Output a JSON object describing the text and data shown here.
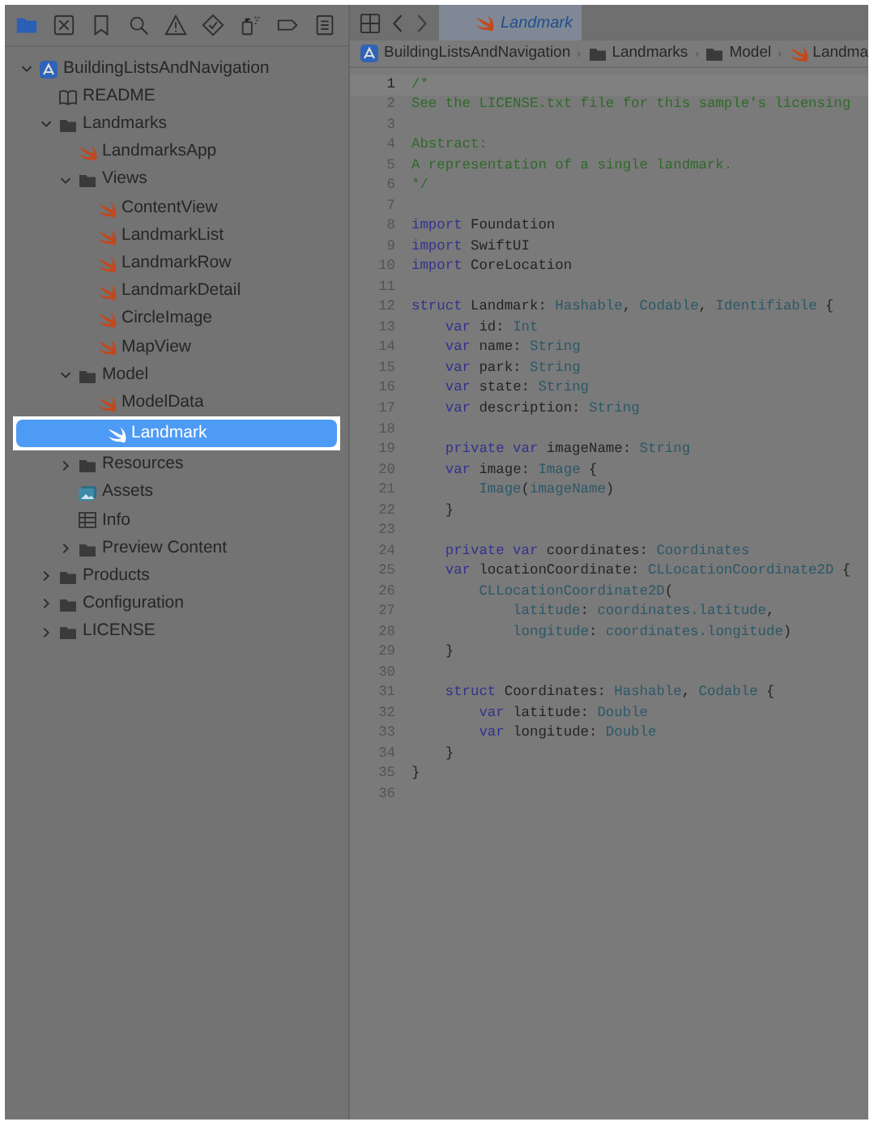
{
  "navigator_tabs": [
    {
      "kind": "folder",
      "selected": true
    },
    {
      "kind": "xsquare",
      "selected": false
    },
    {
      "kind": "bookmark",
      "selected": false
    },
    {
      "kind": "search",
      "selected": false
    },
    {
      "kind": "warning",
      "selected": false
    },
    {
      "kind": "diamond",
      "selected": false
    },
    {
      "kind": "spray",
      "selected": false
    },
    {
      "kind": "capsule",
      "selected": false
    },
    {
      "kind": "doclist",
      "selected": false
    }
  ],
  "editor_tab": {
    "label": "Landmark",
    "kind": "swift"
  },
  "breadcrumb": [
    {
      "label": "BuildingListsAndNavigation",
      "kind": "project"
    },
    {
      "label": "Landmarks",
      "kind": "folder"
    },
    {
      "label": "Model",
      "kind": "folder"
    },
    {
      "label": "Landma",
      "kind": "swift"
    }
  ],
  "tree": [
    {
      "label": "BuildingListsAndNavigation",
      "kind": "project",
      "expanded": true,
      "selected": false,
      "children": [
        {
          "label": "README",
          "kind": "book",
          "selected": false
        },
        {
          "label": "Landmarks",
          "kind": "folder",
          "expanded": true,
          "selected": false,
          "children": [
            {
              "label": "LandmarksApp",
              "kind": "swift",
              "selected": false
            },
            {
              "label": "Views",
              "kind": "folder",
              "expanded": true,
              "selected": false,
              "children": [
                {
                  "label": "ContentView",
                  "kind": "swift",
                  "selected": false
                },
                {
                  "label": "LandmarkList",
                  "kind": "swift",
                  "selected": false
                },
                {
                  "label": "LandmarkRow",
                  "kind": "swift",
                  "selected": false
                },
                {
                  "label": "LandmarkDetail",
                  "kind": "swift",
                  "selected": false
                },
                {
                  "label": "CircleImage",
                  "kind": "swift",
                  "selected": false
                },
                {
                  "label": "MapView",
                  "kind": "swift",
                  "selected": false
                }
              ]
            },
            {
              "label": "Model",
              "kind": "folder",
              "expanded": true,
              "selected": false,
              "children": [
                {
                  "label": "ModelData",
                  "kind": "swift",
                  "selected": false
                },
                {
                  "label": "Landmark",
                  "kind": "swift",
                  "selected": true
                }
              ]
            },
            {
              "label": "Resources",
              "kind": "folder",
              "expanded": false,
              "selected": false
            },
            {
              "label": "Assets",
              "kind": "assets",
              "selected": false
            },
            {
              "label": "Info",
              "kind": "plist",
              "selected": false
            },
            {
              "label": "Preview Content",
              "kind": "folder",
              "expanded": false,
              "selected": false
            }
          ]
        },
        {
          "label": "Products",
          "kind": "folder",
          "expanded": false,
          "selected": false
        },
        {
          "label": "Configuration",
          "kind": "folder",
          "expanded": false,
          "selected": false
        },
        {
          "label": "LICENSE",
          "kind": "folder",
          "expanded": false,
          "selected": false
        }
      ]
    }
  ],
  "code_lines": [
    {
      "number": "1",
      "current": true,
      "tokens": [
        {
          "kind": "comment",
          "text": "/*"
        }
      ]
    },
    {
      "number": "2",
      "current": false,
      "tokens": [
        {
          "kind": "comment",
          "text": "See the LICENSE.txt file for this sample's licensing"
        }
      ]
    },
    {
      "number": "3",
      "current": false
    },
    {
      "number": "4",
      "current": false,
      "tokens": [
        {
          "kind": "comment",
          "text": "Abstract:"
        }
      ]
    },
    {
      "number": "5",
      "current": false,
      "tokens": [
        {
          "kind": "comment",
          "text": "A representation of a single landmark."
        }
      ]
    },
    {
      "number": "6",
      "current": false,
      "tokens": [
        {
          "kind": "comment",
          "text": "*/"
        }
      ]
    },
    {
      "number": "7",
      "current": false
    },
    {
      "number": "8",
      "current": false,
      "tokens": [
        {
          "kind": "keyword",
          "text": "import"
        },
        {
          "kind": "plain",
          "text": " Foundation"
        }
      ]
    },
    {
      "number": "9",
      "current": false,
      "tokens": [
        {
          "kind": "keyword",
          "text": "import"
        },
        {
          "kind": "plain",
          "text": " SwiftUI"
        }
      ]
    },
    {
      "number": "10",
      "current": false,
      "tokens": [
        {
          "kind": "keyword",
          "text": "import"
        },
        {
          "kind": "plain",
          "text": " CoreLocation"
        }
      ]
    },
    {
      "number": "11",
      "current": false
    },
    {
      "number": "12",
      "current": false,
      "tokens": [
        {
          "kind": "keyword",
          "text": "struct"
        },
        {
          "kind": "plain",
          "text": " Landmark: "
        },
        {
          "kind": "type",
          "text": "Hashable"
        },
        {
          "kind": "plain",
          "text": ", "
        },
        {
          "kind": "type",
          "text": "Codable"
        },
        {
          "kind": "plain",
          "text": ", "
        },
        {
          "kind": "type",
          "text": "Identifiable"
        },
        {
          "kind": "plain",
          "text": " {"
        }
      ]
    },
    {
      "number": "13",
      "current": false,
      "tokens": [
        {
          "kind": "keyword",
          "text": "    var"
        },
        {
          "kind": "plain",
          "text": " id: "
        },
        {
          "kind": "type",
          "text": "Int"
        }
      ]
    },
    {
      "number": "14",
      "current": false,
      "tokens": [
        {
          "kind": "keyword",
          "text": "    var"
        },
        {
          "kind": "plain",
          "text": " name: "
        },
        {
          "kind": "type",
          "text": "String"
        }
      ]
    },
    {
      "number": "15",
      "current": false,
      "tokens": [
        {
          "kind": "keyword",
          "text": "    var"
        },
        {
          "kind": "plain",
          "text": " park: "
        },
        {
          "kind": "type",
          "text": "String"
        }
      ]
    },
    {
      "number": "16",
      "current": false,
      "tokens": [
        {
          "kind": "keyword",
          "text": "    var"
        },
        {
          "kind": "plain",
          "text": " state: "
        },
        {
          "kind": "type",
          "text": "String"
        }
      ]
    },
    {
      "number": "17",
      "current": false,
      "tokens": [
        {
          "kind": "keyword",
          "text": "    var"
        },
        {
          "kind": "plain",
          "text": " description: "
        },
        {
          "kind": "type",
          "text": "String"
        }
      ]
    },
    {
      "number": "18",
      "current": false
    },
    {
      "number": "19",
      "current": false,
      "tokens": [
        {
          "kind": "keyword",
          "text": "    private var"
        },
        {
          "kind": "plain",
          "text": " imageName: "
        },
        {
          "kind": "type",
          "text": "String"
        }
      ]
    },
    {
      "number": "20",
      "current": false,
      "tokens": [
        {
          "kind": "keyword",
          "text": "    var"
        },
        {
          "kind": "plain",
          "text": " image: "
        },
        {
          "kind": "type",
          "text": "Image"
        },
        {
          "kind": "plain",
          "text": " {"
        }
      ]
    },
    {
      "number": "21",
      "current": false,
      "tokens": [
        {
          "kind": "type",
          "text": "        Image"
        },
        {
          "kind": "plain",
          "text": "("
        },
        {
          "kind": "type",
          "text": "imageName"
        },
        {
          "kind": "plain",
          "text": ")"
        }
      ]
    },
    {
      "number": "22",
      "current": false,
      "tokens": [
        {
          "kind": "plain",
          "text": "    }"
        }
      ]
    },
    {
      "number": "23",
      "current": false
    },
    {
      "number": "24",
      "current": false,
      "tokens": [
        {
          "kind": "keyword",
          "text": "    private var"
        },
        {
          "kind": "plain",
          "text": " coordinates: "
        },
        {
          "kind": "type",
          "text": "Coordinates"
        }
      ]
    },
    {
      "number": "25",
      "current": false,
      "tokens": [
        {
          "kind": "keyword",
          "text": "    var"
        },
        {
          "kind": "plain",
          "text": " locationCoordinate: "
        },
        {
          "kind": "type",
          "text": "CLLocationCoordinate2D"
        },
        {
          "kind": "plain",
          "text": " {"
        }
      ]
    },
    {
      "number": "26",
      "current": false,
      "tokens": [
        {
          "kind": "type",
          "text": "        CLLocationCoordinate2D"
        },
        {
          "kind": "plain",
          "text": "("
        }
      ]
    },
    {
      "number": "27",
      "current": false,
      "tokens": [
        {
          "kind": "type",
          "text": "            latitude"
        },
        {
          "kind": "plain",
          "text": ": "
        },
        {
          "kind": "type",
          "text": "coordinates.latitude"
        },
        {
          "kind": "plain",
          "text": ","
        }
      ]
    },
    {
      "number": "28",
      "current": false,
      "tokens": [
        {
          "kind": "type",
          "text": "            longitude"
        },
        {
          "kind": "plain",
          "text": ": "
        },
        {
          "kind": "type",
          "text": "coordinates.longitude"
        },
        {
          "kind": "plain",
          "text": ")"
        }
      ]
    },
    {
      "number": "29",
      "current": false,
      "tokens": [
        {
          "kind": "plain",
          "text": "    }"
        }
      ]
    },
    {
      "number": "30",
      "current": false
    },
    {
      "number": "31",
      "current": false,
      "tokens": [
        {
          "kind": "keyword",
          "text": "    struct"
        },
        {
          "kind": "plain",
          "text": " Coordinates: "
        },
        {
          "kind": "type",
          "text": "Hashable"
        },
        {
          "kind": "plain",
          "text": ", "
        },
        {
          "kind": "type",
          "text": "Codable"
        },
        {
          "kind": "plain",
          "text": " {"
        }
      ]
    },
    {
      "number": "32",
      "current": false,
      "tokens": [
        {
          "kind": "keyword",
          "text": "        var"
        },
        {
          "kind": "plain",
          "text": " latitude: "
        },
        {
          "kind": "type",
          "text": "Double"
        }
      ]
    },
    {
      "number": "33",
      "current": false,
      "tokens": [
        {
          "kind": "keyword",
          "text": "        var"
        },
        {
          "kind": "plain",
          "text": " longitude: "
        },
        {
          "kind": "type",
          "text": "Double"
        }
      ]
    },
    {
      "number": "34",
      "current": false,
      "tokens": [
        {
          "kind": "plain",
          "text": "    }"
        }
      ]
    },
    {
      "number": "35",
      "current": false,
      "tokens": [
        {
          "kind": "plain",
          "text": "}"
        }
      ]
    },
    {
      "number": "36",
      "current": false
    }
  ]
}
